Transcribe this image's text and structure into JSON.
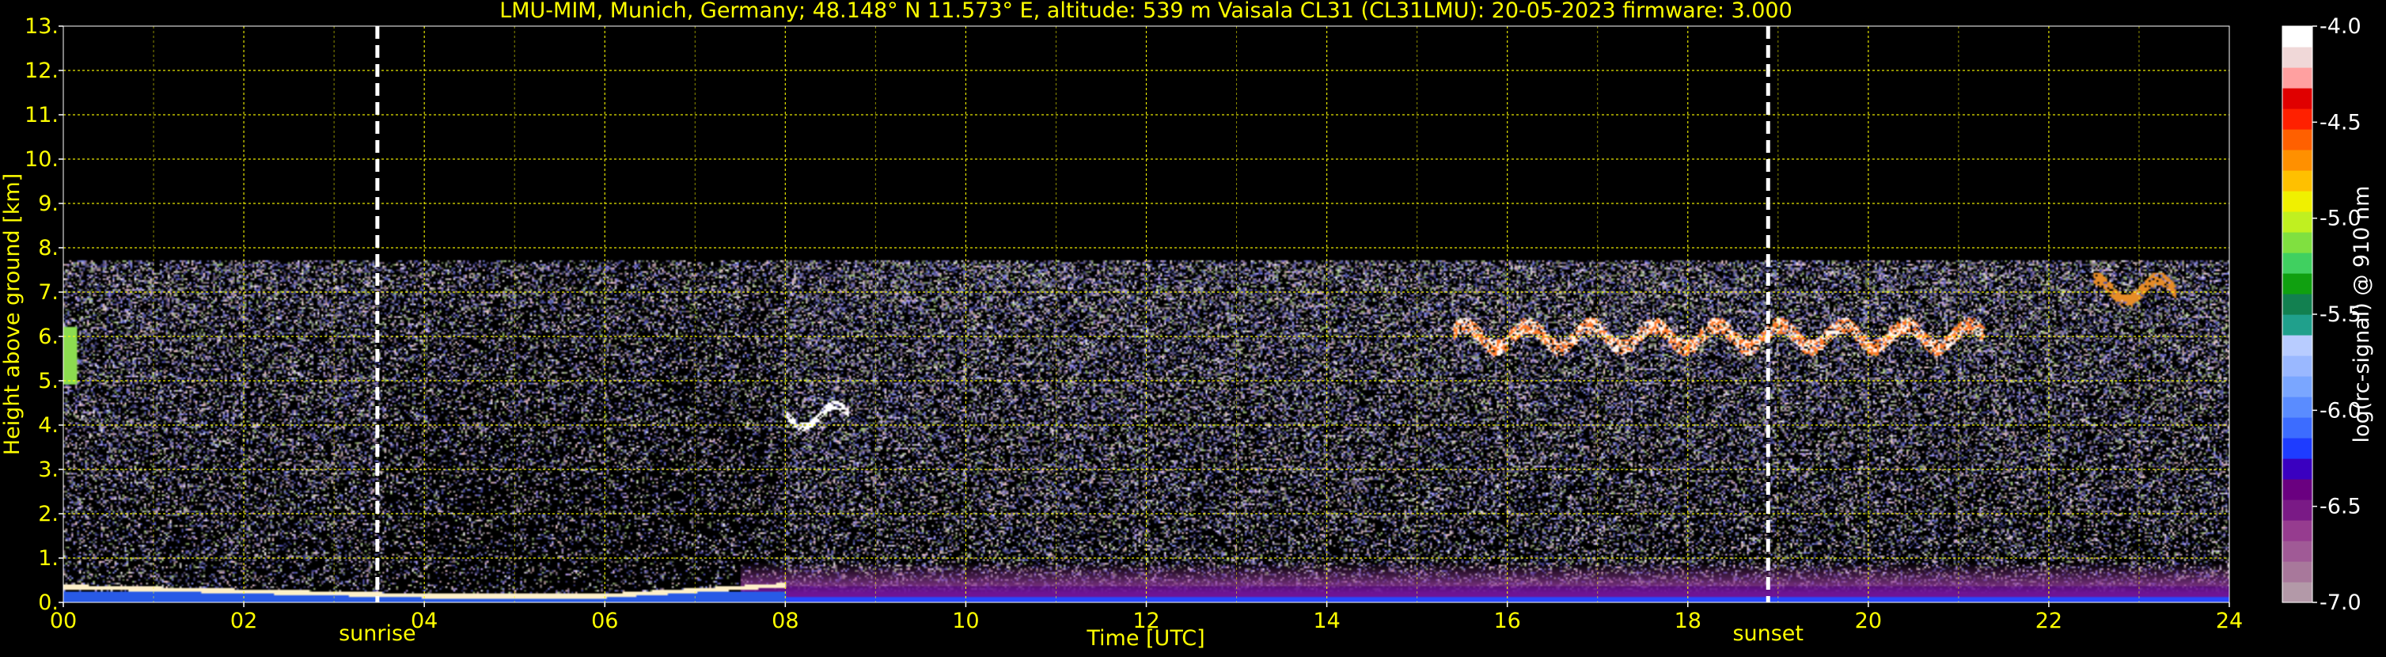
{
  "colors": {
    "text": "#ffff00",
    "grid": "#ffff00",
    "background": "#000000",
    "marker_line": "#ffffff"
  },
  "chart_data": {
    "type": "heatmap",
    "title": "LMU-MIM, Munich, Germany; 48.148° N 11.573° E, altitude: 539 m    Vaisala CL31 (CL31LMU): 20-05-2023    firmware: 3.000",
    "xlabel": "Time [UTC]",
    "ylabel": "Height above ground [km]",
    "xlim": [
      0,
      24
    ],
    "ylim": [
      0,
      13
    ],
    "x_tick_labels": [
      "00",
      "02",
      "04",
      "06",
      "08",
      "10",
      "12",
      "14",
      "16",
      "18",
      "20",
      "22",
      "24"
    ],
    "y_tick_labels": [
      "0.",
      "1.",
      "2.",
      "3.",
      "4.",
      "5.",
      "6.",
      "7.",
      "8.",
      "9.",
      "10.",
      "11.",
      "12.",
      "13."
    ],
    "grid": true,
    "markers": [
      {
        "label": "sunrise",
        "time_h": 3.48
      },
      {
        "label": "sunset",
        "time_h": 18.89
      }
    ],
    "colorbar": {
      "label": "log(rc-signal) @ 910 nm",
      "range": [
        -7.0,
        -4.0
      ],
      "tick_labels": [
        "-4.0",
        "-4.5",
        "-5.0",
        "-5.5",
        "-6.0",
        "-6.5",
        "-7.0"
      ],
      "tick_values": [
        -4.0,
        -4.5,
        -5.0,
        -5.5,
        -6.0,
        -6.5,
        -7.0
      ],
      "colors": [
        "#b399a8",
        "#a8789b",
        "#a05a96",
        "#963c8f",
        "#7a1a86",
        "#6a0080",
        "#3a00c0",
        "#1e3cff",
        "#3c6cff",
        "#5a8cff",
        "#7aa6ff",
        "#9ab8ff",
        "#b8ccff",
        "#20a08c",
        "#128050",
        "#10a010",
        "#40d060",
        "#80e040",
        "#c0f020",
        "#f0f000",
        "#ffc000",
        "#ff9000",
        "#ff6000",
        "#ff2000",
        "#e00000",
        "#ffa0a0",
        "#f0d8d8",
        "#ffffff"
      ]
    },
    "regions": [
      {
        "feature": "boundary layer top (bright line)",
        "t_start_h": 0,
        "t_end_h": 8,
        "height_km": [
          0.35,
          0.15,
          0.4
        ]
      },
      {
        "feature": "surface aerosol layer (blue/purple)",
        "t_start_h": 7.5,
        "t_end_h": 24,
        "height_km": [
          0.0,
          0.9
        ]
      },
      {
        "feature": "noise / signal limit",
        "t_start_h": 0,
        "t_end_h": 24,
        "height_km": [
          0,
          7.7
        ]
      },
      {
        "feature": "cloud near 4.2 km",
        "t_start_h": 8.0,
        "t_end_h": 8.7,
        "height_km": [
          4.0,
          4.3
        ]
      },
      {
        "feature": "mid-level clouds",
        "t_start_h": 15.4,
        "t_end_h": 21.3,
        "height_km": [
          5.5,
          6.7
        ]
      },
      {
        "feature": "high cloud",
        "t_start_h": 22.5,
        "t_end_h": 23.4,
        "height_km": [
          6.8,
          7.3
        ]
      }
    ]
  }
}
